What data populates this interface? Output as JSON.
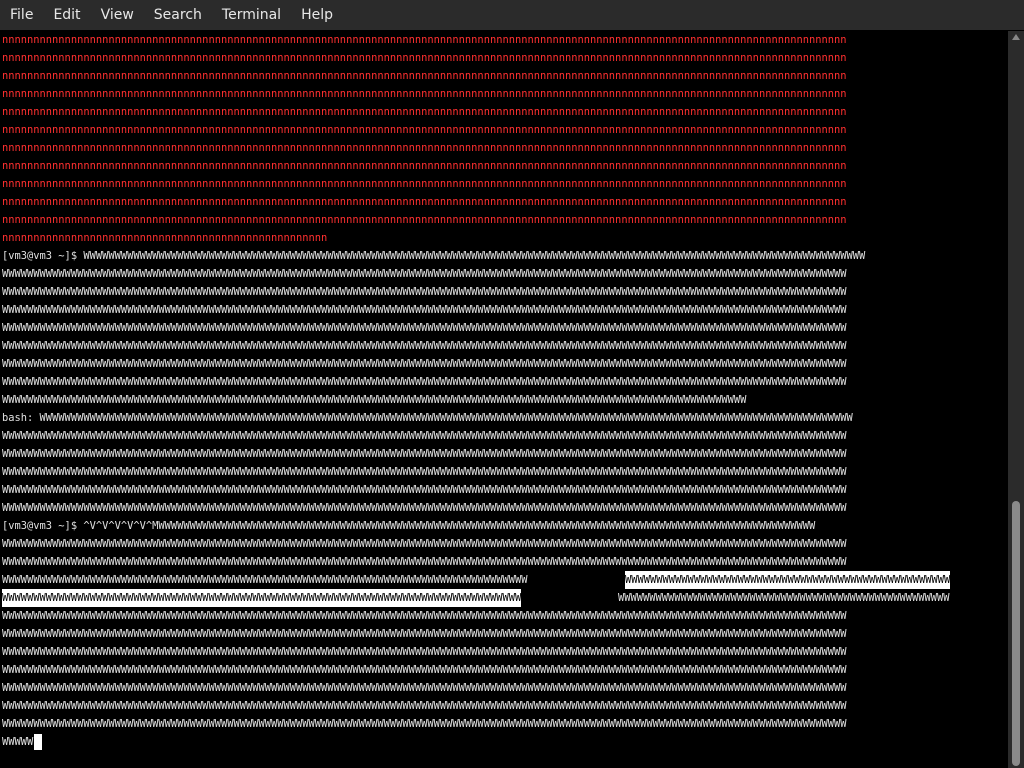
{
  "menu": {
    "items": [
      "File",
      "Edit",
      "View",
      "Search",
      "Terminal",
      "Help"
    ]
  },
  "terminal": {
    "red_full": "nnnnnnnnnnnnnnnnnnnnnnnnnnnnnnnnnnnnnnnnnnnnnnnnnnnnnnnnnnnnnnnnnnnnnnnnnnnnnnnnnnnnnnnnnnnnnnnnnnnnnnnnnnnnnnnnnnnnnnnnnnnnnnnnnnnnnnn",
    "red_partial": "nnnnnnnnnnnnnnnnnnnnnnnnnnnnnnnnnnnnnnnnnnnnnnnnnnnn",
    "prompt1": "[vm3@vm3 ~]$ WWWWWWWWWWWWWWWWWWWWWWWWWWWWWWWWWWWWWWWWWWWWWWWWWWWWWWWWWWWWWWWWWWWWWWWWWWWWWWWWWWWWWWWWWWWWWWWWWWWWWWWWWWWWWWWWWWWWWWWWWWWWW",
    "w_full": "WWWWWWWWWWWWWWWWWWWWWWWWWWWWWWWWWWWWWWWWWWWWWWWWWWWWWWWWWWWWWWWWWWWWWWWWWWWWWWWWWWWWWWWWWWWWWWWWWWWWWWWWWWWWWWWWWWWWWWWWWWWWWWWWWWWWWWW",
    "w_partial1": "WWWWWWWWWWWWWWWWWWWWWWWWWWWWWWWWWWWWWWWWWWWWWWWWWWWWWWWWWWWWWWWWWWWWWWWWWWWWWWWWWWWWWWWWWWWWWWWWWWWWWWWWWWWWWWWWWWWWWWW",
    "bash_line": "bash: WWWWWWWWWWWWWWWWWWWWWWWWWWWWWWWWWWWWWWWWWWWWWWWWWWWWWWWWWWWWWWWWWWWWWWWWWWWWWWWWWWWWWWWWWWWWWWWWWWWWWWWWWWWWWWWWWWWWWWWWWWWWWWWWWW",
    "prompt2": "[vm3@vm3 ~]$ ^V^V^V^V^V^MWWWWWWWWWWWWWWWWWWWWWWWWWWWWWWWWWWWWWWWWWWWWWWWWWWWWWWWWWWWWWWWWWWWWWWWWWWWWWWWWWWWWWWWWWWWWWWWWWWWWWWWWW",
    "sel_left": "WWWWWWWWWWWWWWWWWWWWWWWWWWWWWWWWWWWWWWWWWWWWWWWWWWWWWWWWWWWWWWWWWWWWWWWWWWWWWWWWWWWW",
    "sel_right": "WWWWWWWWWWWWWWWWWWWWWWWWWWWWWWWWWWWWWWWWWWWWWWWWWWWW",
    "sel2_left": "WWWWWWWWWWWWWWWWWWWWWWWWWWWWWWWWWWWWWWWWWWWWWWWWWWWWWWWWWWWWWWWWWWWWWWWWWWWWWWWWWWW",
    "sel2_right": "WWWWWWWWWWWWWWWWWWWWWWWWWWWWWWWWWWWWWWWWWWWWWWWWWWWWW",
    "last": "WWWWW"
  }
}
